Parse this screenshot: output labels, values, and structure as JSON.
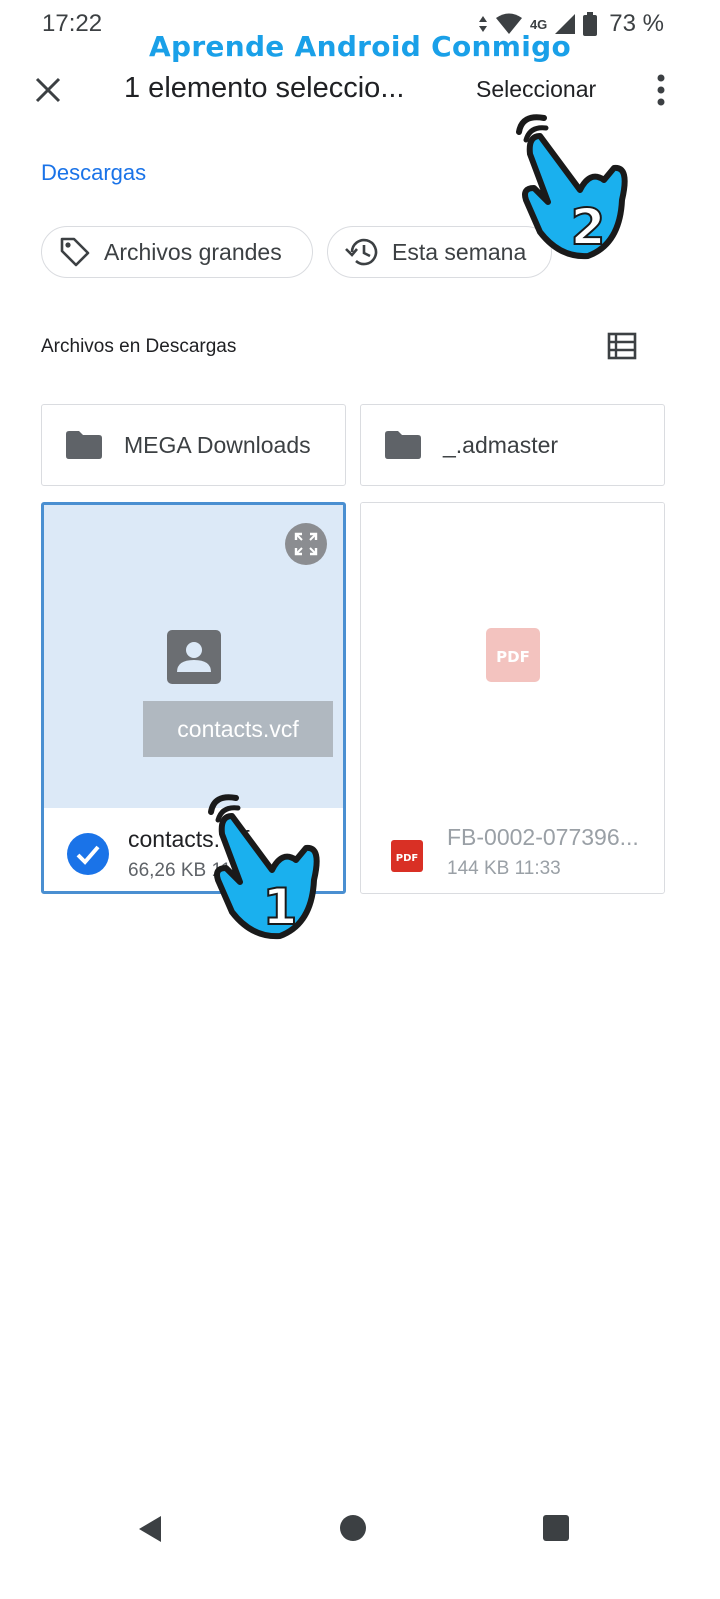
{
  "status_bar": {
    "time": "17:22",
    "network": "4G",
    "battery": "73 %"
  },
  "watermark": "Aprende Android Conmigo",
  "toolbar": {
    "title": "1 elemento seleccio...",
    "select_label": "Seleccionar"
  },
  "breadcrumb": "Descargas",
  "chips": [
    {
      "label": "Archivos grandes",
      "icon": "tag-icon"
    },
    {
      "label": "Esta semana",
      "icon": "history-icon"
    }
  ],
  "section_title": "Archivos en Descargas",
  "folders": [
    {
      "name": "MEGA Downloads"
    },
    {
      "name": "_.admaster"
    }
  ],
  "files": [
    {
      "name": "contacts.vcf",
      "thumb_label": "contacts.vcf",
      "meta": "66,26 KB  11:",
      "selected": true
    },
    {
      "name": "FB-0002-077396...",
      "meta": "144 KB  11:33",
      "selected": false,
      "badge": "PDF"
    }
  ],
  "tap_markers": [
    "1",
    "2"
  ],
  "colors": {
    "accent": "#1a73e8",
    "watermark": "#1aa0e8",
    "selection_bg": "#dce9f7",
    "pdf_red": "#d93025"
  }
}
